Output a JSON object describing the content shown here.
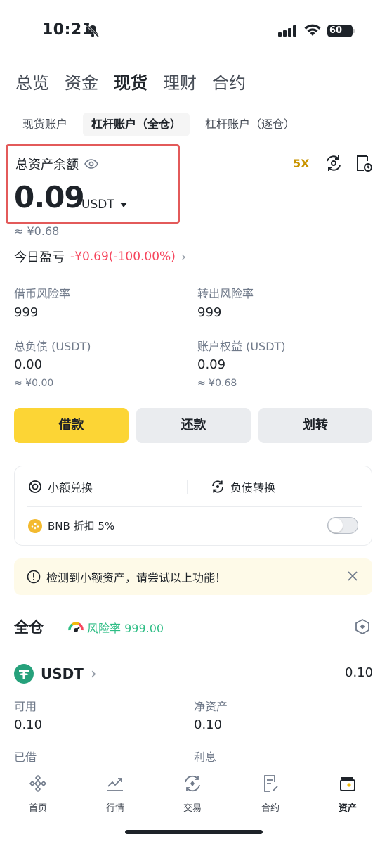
{
  "status_bar": {
    "time": "10:21",
    "battery": "60"
  },
  "top_tabs": [
    "总览",
    "资金",
    "现货",
    "理财",
    "合约"
  ],
  "top_tab_active": 2,
  "sub_tabs": [
    "现货账户",
    "杠杆账户（全仓）",
    "杠杆账户（逐仓）"
  ],
  "sub_tab_active": 1,
  "balance": {
    "label": "总资产余额",
    "value": "0.09",
    "unit": "USDT",
    "approx": "≈ ¥0.68",
    "leverage": "5X"
  },
  "pnl": {
    "label": "今日盈亏",
    "value": "-¥0.69(-100.00%)"
  },
  "metrics": {
    "borrow_risk_label": "借币风险率",
    "borrow_risk_value": "999",
    "transfer_risk_label": "转出风险率",
    "transfer_risk_value": "999",
    "total_debt_label": "总负债 (USDT)",
    "total_debt_value": "0.00",
    "total_debt_approx": "≈ ¥0.00",
    "equity_label": "账户权益 (USDT)",
    "equity_value": "0.09",
    "equity_approx": "≈ ¥0.68"
  },
  "actions": {
    "borrow": "借款",
    "repay": "还款",
    "transfer": "划转"
  },
  "card": {
    "small_convert": "小额兑换",
    "debt_convert": "负债转换",
    "bnb_discount": "BNB 折扣 5%"
  },
  "notice": {
    "text": "检测到小额资产，请尝试以上功能！"
  },
  "cross": {
    "title": "全仓",
    "risk": "风险率 999.00"
  },
  "asset": {
    "coin": "USDT",
    "amount": "0.10",
    "available_label": "可用",
    "available_value": "0.10",
    "net_label": "净资产",
    "net_value": "0.10",
    "borrowed_label": "已借",
    "interest_label": "利息"
  },
  "bottom_nav": [
    {
      "label": "首页",
      "icon": "home-icon"
    },
    {
      "label": "行情",
      "icon": "markets-icon"
    },
    {
      "label": "交易",
      "icon": "trade-icon"
    },
    {
      "label": "合约",
      "icon": "futures-icon"
    },
    {
      "label": "资产",
      "icon": "wallet-icon"
    }
  ],
  "bottom_nav_active": 4,
  "colors": {
    "brand_yellow": "#fcd535",
    "negative": "#f6465d",
    "positive": "#2ebd85",
    "highlight_box": "#e35a5a"
  }
}
